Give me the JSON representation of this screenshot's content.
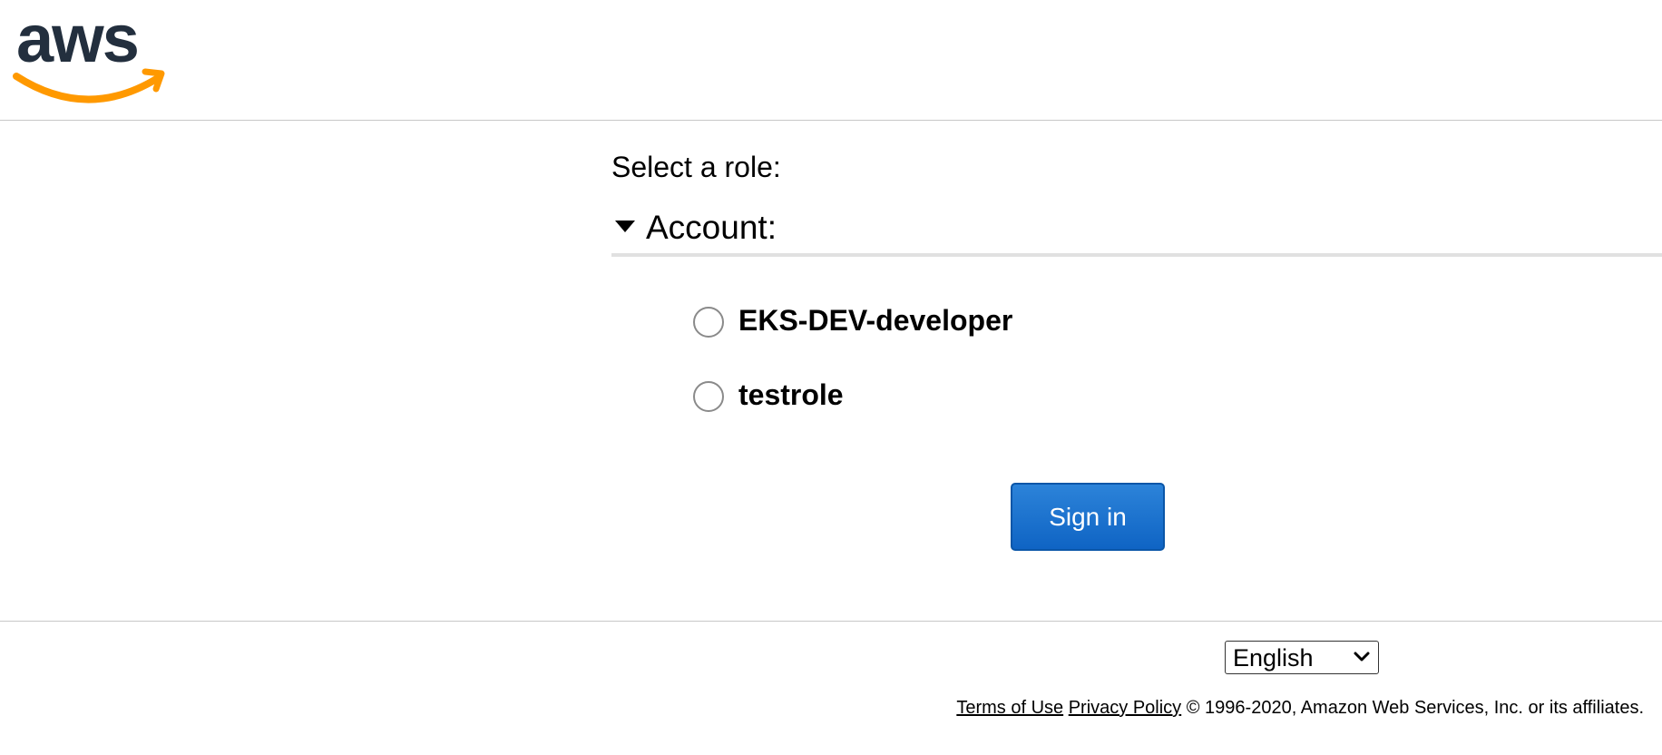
{
  "header": {
    "logo_icon": "aws-logo-icon",
    "brand_colors": {
      "text": "#232f3e",
      "smile": "#ff9900"
    }
  },
  "main": {
    "select_role_label": "Select a role:",
    "account_label": "Account:",
    "roles": [
      {
        "label": "EKS-DEV-developer",
        "selected": false
      },
      {
        "label": "testrole",
        "selected": false
      }
    ],
    "signin_label": "Sign in"
  },
  "footer": {
    "language": {
      "selected": "English"
    },
    "terms_label": "Terms of Use",
    "privacy_label": "Privacy Policy",
    "copyright": "© 1996-2020, Amazon Web Services, Inc. or its affiliates."
  },
  "colors": {
    "button": "#1a73d1",
    "divider": "#c8c8c8"
  }
}
